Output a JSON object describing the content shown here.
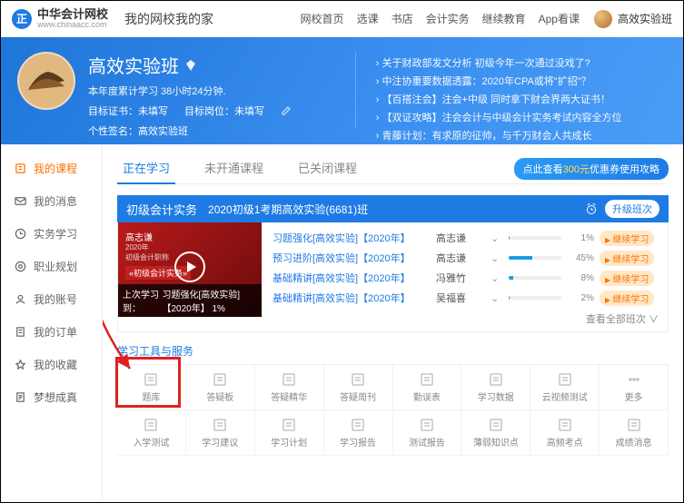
{
  "top": {
    "brand": "中华会计网校",
    "brand_sub": "www.chinaacc.com",
    "slogan": "我的网校我的家",
    "nav": [
      "网校首页",
      "选课",
      "书店",
      "会计实务",
      "继续教育",
      "App看课"
    ],
    "username": "高效实验班"
  },
  "banner": {
    "title": "高效实验班",
    "time_label": "本年度累计学习 38小时24分钟.",
    "cert_label": "目标证书：",
    "cert_value": "未填写",
    "post_label": "目标岗位：",
    "post_value": "未填写",
    "sign_label": "个性签名：",
    "sign_value": "高效实验班",
    "news": [
      "关于财政部发文分析 初级今年一次通过没戏了?",
      "中注协重要数据透露：2020年CPA或将\"扩招\"？",
      "【百搭注会】注会+中级 同时拿下财会界两大证书！",
      "【双证攻略】注会会计与中级会计实务考试内容全方位",
      "青藤计划：有求原的征帅，与千万财会人共成长"
    ]
  },
  "sidebar": [
    {
      "icon": "book",
      "label": "我的课程",
      "active": true
    },
    {
      "icon": "mail",
      "label": "我的消息"
    },
    {
      "icon": "clock",
      "label": "实务学习"
    },
    {
      "icon": "target",
      "label": "职业规划"
    },
    {
      "icon": "user",
      "label": "我的账号"
    },
    {
      "icon": "order",
      "label": "我的订单"
    },
    {
      "icon": "star",
      "label": "我的收藏"
    },
    {
      "icon": "note",
      "label": "梦想成真"
    }
  ],
  "tabs": {
    "items": [
      "正在学习",
      "未开通课程",
      "已关闭课程"
    ],
    "active": 0,
    "promo_prefix": "点此查看",
    "promo_amount": "300元",
    "promo_suffix": "优惠券使用攻略"
  },
  "course": {
    "title": "初级会计实务",
    "class_name": "2020初级1考期高效实验(6681)班",
    "upgrade_btn": "升级班次",
    "thumb_label": "«初级会计实务»",
    "last_learn_label": "上次学习到：",
    "last_learn_value": "习题强化[高效实验]【2020年】 1%",
    "lessons": [
      {
        "name": "习题强化[高效实验]【2020年】",
        "teacher": "高志谦",
        "pct": 1
      },
      {
        "name": "预习进阶[高效实验]【2020年】",
        "teacher": "高志谦",
        "pct": 45
      },
      {
        "name": "基础精讲[高效实验]【2020年】",
        "teacher": "冯雅竹",
        "pct": 8
      },
      {
        "name": "基础精讲[高效实验]【2020年】",
        "teacher": "吴福喜",
        "pct": 2
      }
    ],
    "continue_btn": "继续学习",
    "more": "查看全部班次 ∨"
  },
  "tools": {
    "title": "学习工具与服务",
    "row1": [
      "题库",
      "答疑板",
      "答疑精华",
      "答疑周刊",
      "勤误表",
      "学习数据",
      "云视频测试",
      "更多"
    ],
    "row2": [
      "入学测试",
      "学习建议",
      "学习计划",
      "学习报告",
      "测试报告",
      "薄弱知识点",
      "高频考点",
      "成绩消息"
    ]
  }
}
